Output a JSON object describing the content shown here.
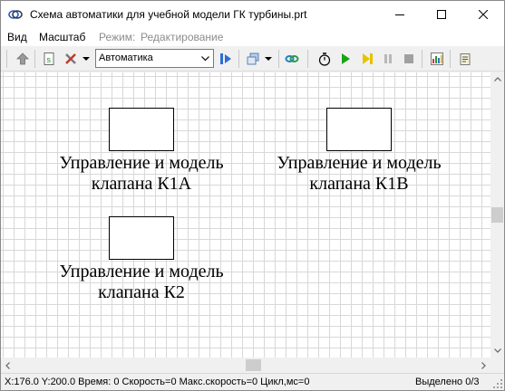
{
  "window": {
    "title": "Схема автоматики для учебной модели ГК турбины.prt"
  },
  "menu": {
    "items": [
      "Вид",
      "Масштаб"
    ],
    "mode_label": "Режим:",
    "mode_value": "Редактирование"
  },
  "toolbar": {
    "mode_select": "Автоматика"
  },
  "canvas": {
    "blocks": [
      {
        "line1": "Управление и модель",
        "line2": "клапана К1А"
      },
      {
        "line1": "Управление и модель",
        "line2": "клапана К1В"
      },
      {
        "line1": "Управление и модель",
        "line2": "клапана К2"
      }
    ]
  },
  "status": {
    "info": "X:176.0  Y:200.0 Время: 0 Скорость=0 Макс.скорость=0 Цикл,мс=0",
    "selected": "Выделено 0/3"
  },
  "colors": {
    "grid": "#d8d8d8",
    "play": "#1aa31a",
    "step": "#e6c200"
  }
}
